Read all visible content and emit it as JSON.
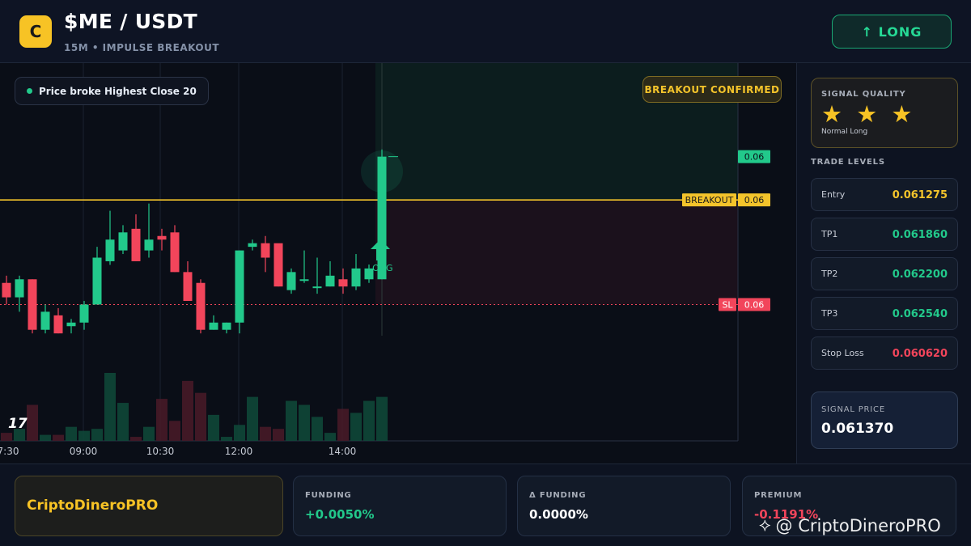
{
  "header": {
    "logo_letter": "C",
    "pair": "$ME / USDT",
    "subtitle": "15M • IMPULSE BREAKOUT",
    "action_label": "↑ LONG"
  },
  "chart": {
    "legend_text": "Price broke Highest Close 20",
    "confirm_label": "BREAKOUT CONFIRMED",
    "breakout_tag": "BREAKOUT",
    "breakout_value": "0.06",
    "current_value": "0.06",
    "sl_tag": "SL",
    "sl_value": "0.06",
    "signal_marker_label": "LONG",
    "tv_logo": "17",
    "time_labels": [
      "7:30",
      "09:00",
      "10:30",
      "12:00",
      "14:00"
    ],
    "colors": {
      "up": "#22c98b",
      "down": "#f2455b",
      "breakout": "#f4c42b"
    }
  },
  "chart_data": {
    "type": "candlestick",
    "candles": [
      {
        "o": 0.0612,
        "h": 0.0614,
        "l": 0.0606,
        "c": 0.0608
      },
      {
        "o": 0.0608,
        "h": 0.0614,
        "l": 0.0604,
        "c": 0.0613
      },
      {
        "o": 0.0613,
        "h": 0.0613,
        "l": 0.0598,
        "c": 0.0599
      },
      {
        "o": 0.0599,
        "h": 0.0606,
        "l": 0.0598,
        "c": 0.0604
      },
      {
        "o": 0.0603,
        "h": 0.0605,
        "l": 0.0598,
        "c": 0.0598
      },
      {
        "o": 0.06,
        "h": 0.0602,
        "l": 0.0598,
        "c": 0.0601
      },
      {
        "o": 0.0601,
        "h": 0.0607,
        "l": 0.0599,
        "c": 0.0606
      },
      {
        "o": 0.0606,
        "h": 0.0622,
        "l": 0.0606,
        "c": 0.0619
      },
      {
        "o": 0.0618,
        "h": 0.0632,
        "l": 0.0617,
        "c": 0.0624
      },
      {
        "o": 0.0621,
        "h": 0.0628,
        "l": 0.062,
        "c": 0.0626
      },
      {
        "o": 0.0627,
        "h": 0.0631,
        "l": 0.0618,
        "c": 0.0618
      },
      {
        "o": 0.0621,
        "h": 0.0634,
        "l": 0.0619,
        "c": 0.0624
      },
      {
        "o": 0.0625,
        "h": 0.0627,
        "l": 0.0621,
        "c": 0.0624
      },
      {
        "o": 0.0626,
        "h": 0.0628,
        "l": 0.0615,
        "c": 0.0615
      },
      {
        "o": 0.0615,
        "h": 0.0618,
        "l": 0.0607,
        "c": 0.0607
      },
      {
        "o": 0.0612,
        "h": 0.0613,
        "l": 0.0598,
        "c": 0.0599
      },
      {
        "o": 0.0599,
        "h": 0.0603,
        "l": 0.0599,
        "c": 0.0601
      },
      {
        "o": 0.0599,
        "h": 0.0601,
        "l": 0.0598,
        "c": 0.0601
      },
      {
        "o": 0.0601,
        "h": 0.0621,
        "l": 0.0598,
        "c": 0.0621
      },
      {
        "o": 0.0622,
        "h": 0.0624,
        "l": 0.0621,
        "c": 0.0623
      },
      {
        "o": 0.0623,
        "h": 0.0625,
        "l": 0.0615,
        "c": 0.0619
      },
      {
        "o": 0.0623,
        "h": 0.0622,
        "l": 0.0611,
        "c": 0.0611
      },
      {
        "o": 0.061,
        "h": 0.0616,
        "l": 0.0609,
        "c": 0.0615
      },
      {
        "o": 0.0613,
        "h": 0.0621,
        "l": 0.0612,
        "c": 0.0613
      },
      {
        "o": 0.0611,
        "h": 0.0619,
        "l": 0.0609,
        "c": 0.0611
      },
      {
        "o": 0.0611,
        "h": 0.0618,
        "l": 0.0611,
        "c": 0.0614
      },
      {
        "o": 0.0613,
        "h": 0.0616,
        "l": 0.0609,
        "c": 0.0611
      },
      {
        "o": 0.0611,
        "h": 0.062,
        "l": 0.061,
        "c": 0.0616
      },
      {
        "o": 0.0613,
        "h": 0.0617,
        "l": 0.0612,
        "c": 0.0616
      },
      {
        "o": 0.0613,
        "h": 0.0649,
        "l": 0.0613,
        "c": 0.0647
      }
    ],
    "volumes": [
      4,
      6,
      18,
      3,
      3,
      7,
      5,
      6,
      34,
      19,
      2,
      7,
      21,
      10,
      30,
      24,
      13,
      2,
      8,
      22,
      7,
      6,
      20,
      18,
      12,
      4,
      16,
      14,
      20,
      22
    ],
    "levels": {
      "breakout": 0.0635,
      "stop_loss": 0.0606,
      "current": 0.0647
    },
    "ylim": [
      0.0594,
      0.0668
    ]
  },
  "sidebar": {
    "quality_title": "SIGNAL QUALITY",
    "stars": "★ ★ ★",
    "star_rating": 3,
    "quality_sub": "Normal Long",
    "levels_title": "TRADE LEVELS",
    "levels": [
      {
        "label": "Entry",
        "value": "0.061275",
        "color": "#f4c42b"
      },
      {
        "label": "TP1",
        "value": "0.061860",
        "color": "#22c98b"
      },
      {
        "label": "TP2",
        "value": "0.062200",
        "color": "#22c98b"
      },
      {
        "label": "TP3",
        "value": "0.062540",
        "color": "#22c98b"
      },
      {
        "label": "Stop Loss",
        "value": "0.060620",
        "color": "#f2455b"
      }
    ],
    "signal_title": "SIGNAL PRICE",
    "signal_value": "0.061370"
  },
  "footer": {
    "brand": "CriptoDineroPRO",
    "stats": [
      {
        "title": "FUNDING",
        "value": "+0.0050%",
        "color": "#22c98b"
      },
      {
        "title": "Δ FUNDING",
        "value": "0.0000%",
        "color": "#ffffff"
      },
      {
        "title": "PREMIUM",
        "value": "-0.1191%",
        "color": "#f2455b"
      }
    ],
    "watermark": "@ CriptoDineroPRO"
  }
}
